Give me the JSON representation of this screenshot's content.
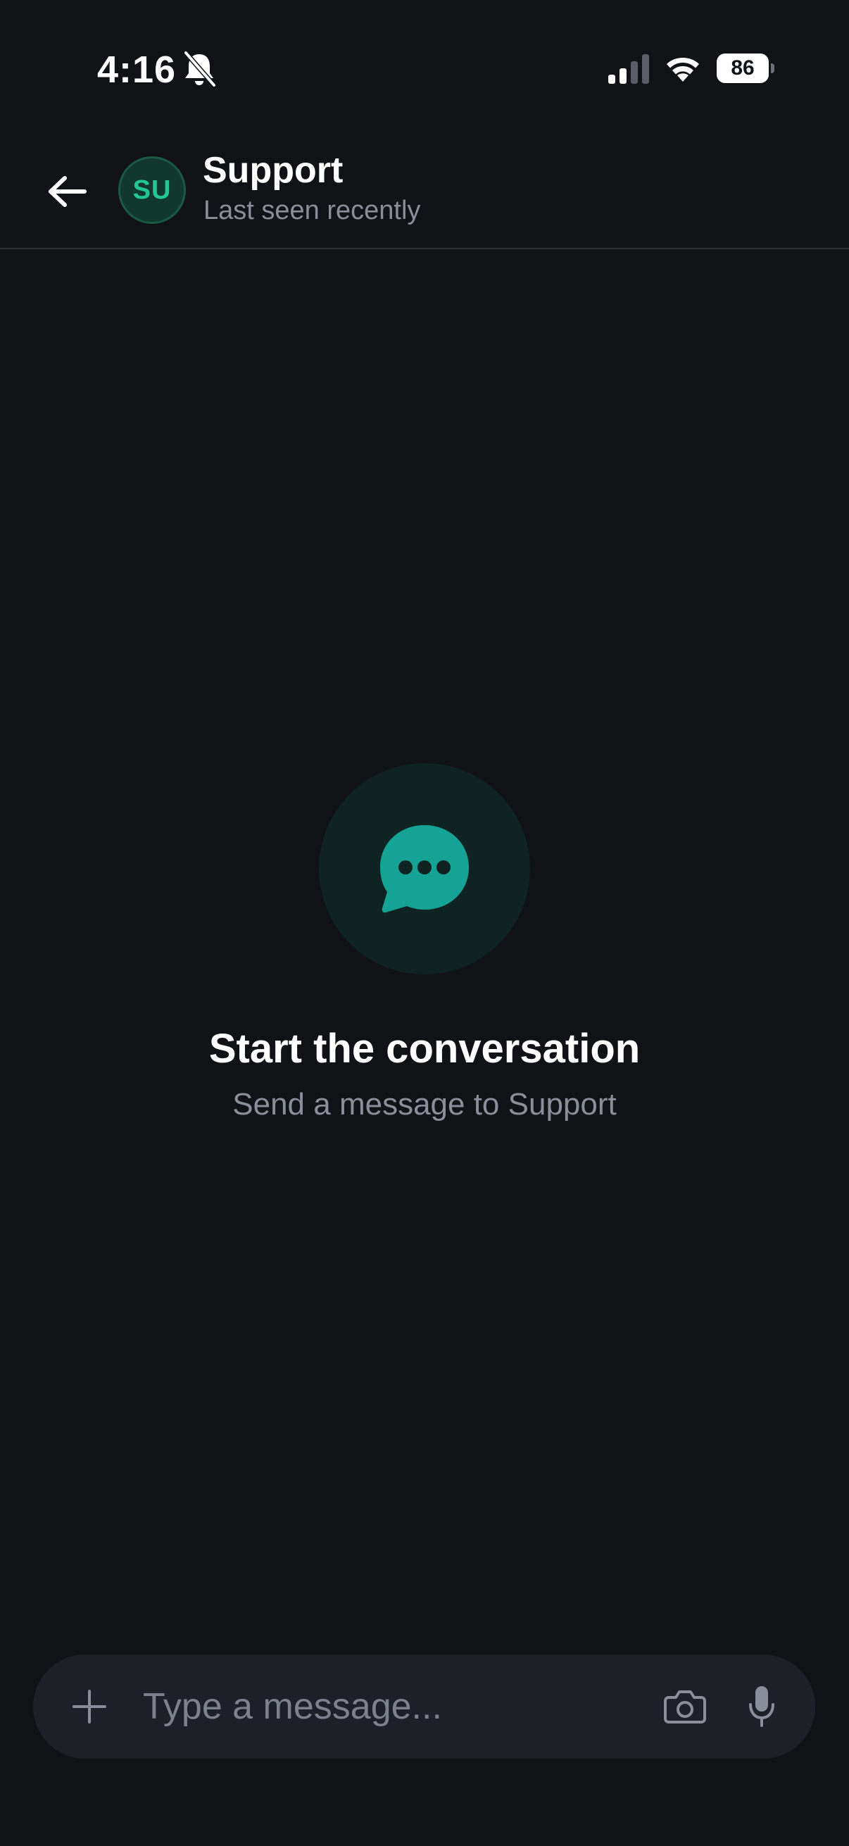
{
  "status_bar": {
    "time": "4:16",
    "battery_level": "86",
    "icons": [
      "bell-off-icon",
      "cellular-signal-icon",
      "wifi-icon",
      "battery-icon"
    ]
  },
  "header": {
    "avatar_initials": "SU",
    "contact_name": "Support",
    "contact_status": "Last seen recently",
    "back_icon": "arrow-left-icon"
  },
  "empty_state": {
    "icon": "chat-bubble-dots-icon",
    "title": "Start the conversation",
    "subtitle": "Send a message to Support"
  },
  "composer": {
    "placeholder": "Type a message...",
    "value": "",
    "icons": [
      "plus-icon",
      "camera-icon",
      "microphone-icon"
    ]
  },
  "colors": {
    "background": "#111216",
    "accent_green": "#22c793",
    "avatar_bg": "#12382d",
    "chat_icon_teal": "#14a394",
    "muted_text": "#8a8e98",
    "composer_bg": "#1e2027"
  }
}
